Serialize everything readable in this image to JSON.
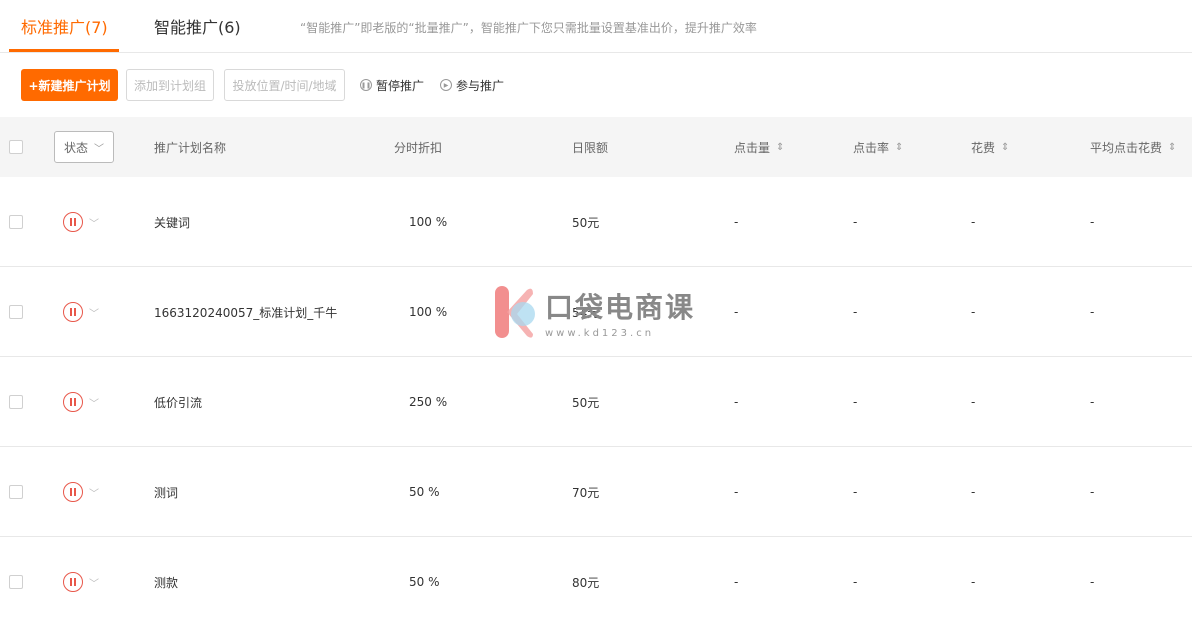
{
  "tabs": {
    "standard": "标准推广(7)",
    "smart": "智能推广(6)",
    "note": "“智能推广”即老版的“批量推广”，智能推广下您只需批量设置基准出价，提升推广效率"
  },
  "toolbar": {
    "new_plan": "+新建推广计划",
    "add_to_group": "添加到计划组",
    "location_time_region": "投放位置/时间/地域",
    "pause": "暂停推广",
    "join": "参与推广"
  },
  "table": {
    "status_filter": "状态",
    "columns": {
      "plan_name": "推广计划名称",
      "time_discount": "分时折扣",
      "daily_limit": "日限额",
      "clicks": "点击量",
      "ctr": "点击率",
      "cost": "花费",
      "avg_cpc": "平均点击花费"
    },
    "rows": [
      {
        "name": "关键词",
        "discount": "100 %",
        "limit": "50元",
        "clicks": "-",
        "ctr": "-",
        "cost": "-",
        "cpc": "-"
      },
      {
        "name": "1663120240057_标准计划_千牛",
        "discount": "100 %",
        "limit": "54元",
        "clicks": "-",
        "ctr": "-",
        "cost": "-",
        "cpc": "-"
      },
      {
        "name": "低价引流",
        "discount": "250 %",
        "limit": "50元",
        "clicks": "-",
        "ctr": "-",
        "cost": "-",
        "cpc": "-"
      },
      {
        "name": "测词",
        "discount": "50 %",
        "limit": "70元",
        "clicks": "-",
        "ctr": "-",
        "cost": "-",
        "cpc": "-"
      },
      {
        "name": "测款",
        "discount": "50 %",
        "limit": "80元",
        "clicks": "-",
        "ctr": "-",
        "cost": "-",
        "cpc": "-"
      }
    ]
  },
  "watermark": {
    "brand": "口袋电商课",
    "url": "www.kd123.cn"
  },
  "colors": {
    "accent": "#ff6a00",
    "pause": "#e8574a"
  }
}
